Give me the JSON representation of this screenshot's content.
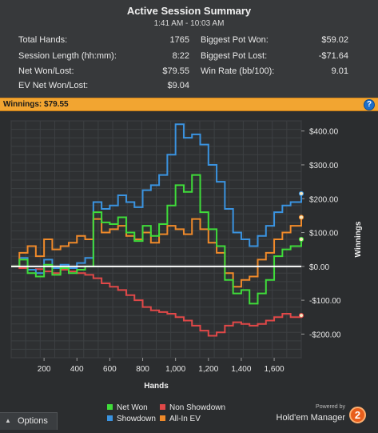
{
  "summary": {
    "title": "Active Session Summary",
    "time_range": "1:41 AM - 10:03 AM",
    "left_stats": [
      {
        "label": "Total Hands:",
        "value": "1765"
      },
      {
        "label": "Session Length (hh:mm):",
        "value": "8:22"
      },
      {
        "label": "Net Won/Lost:",
        "value": "$79.55"
      },
      {
        "label": "EV Net Won/Lost:",
        "value": "$9.04"
      }
    ],
    "right_stats": [
      {
        "label": "Biggest Pot Won:",
        "value": "$59.02"
      },
      {
        "label": "Biggest Pot Lost:",
        "value": "-$71.64"
      },
      {
        "label": "Win Rate (bb/100):",
        "value": "9.01"
      }
    ]
  },
  "winnings_bar": {
    "text": "Winnings: $79.55",
    "help_icon": "help-icon"
  },
  "legend": {
    "net_won": "Net Won",
    "non_showdown": "Non Showdown",
    "showdown": "Showdown",
    "all_in_ev": "All-In EV"
  },
  "branding": {
    "powered_by": "Powered by",
    "product": "Hold'em Manager",
    "logo_text": "2"
  },
  "options": {
    "label": "Options",
    "icon": "caret-up-icon"
  },
  "colors": {
    "net_won": "#3fdc3a",
    "non_showdown": "#e04848",
    "showdown": "#3a93e0",
    "all_in_ev": "#f08a2a",
    "zero_line": "#ffffff",
    "accent_bar": "#f2a531"
  },
  "chart_data": {
    "type": "line",
    "xlabel": "Hands",
    "ylabel": "Winnings",
    "xlim": [
      0,
      1765
    ],
    "ylim": [
      -270,
      430
    ],
    "x_ticks": [
      200,
      400,
      600,
      800,
      1000,
      1200,
      1400,
      1600
    ],
    "x_tick_labels": [
      "200",
      "400",
      "600",
      "800",
      "1,000",
      "1,200",
      "1,400",
      "1,600"
    ],
    "y_ticks": [
      400,
      300,
      200,
      100,
      0,
      -100,
      -200
    ],
    "y_tick_labels": [
      "$400.00",
      "$300.00",
      "$200.00",
      "$100.00",
      "$0.00",
      "-$100.00",
      "-$200.00"
    ],
    "grid": true,
    "legend_position": "bottom",
    "x": [
      0,
      50,
      100,
      150,
      200,
      250,
      300,
      350,
      400,
      450,
      500,
      550,
      600,
      650,
      700,
      750,
      800,
      850,
      900,
      950,
      1000,
      1050,
      1100,
      1150,
      1200,
      1250,
      1300,
      1350,
      1400,
      1450,
      1500,
      1550,
      1600,
      1650,
      1700,
      1765
    ],
    "series": [
      {
        "name": "Net Won",
        "values": [
          0,
          20,
          -20,
          -30,
          5,
          -25,
          -5,
          -20,
          -10,
          0,
          160,
          130,
          125,
          145,
          100,
          75,
          120,
          90,
          125,
          180,
          240,
          220,
          270,
          160,
          110,
          60,
          -40,
          -80,
          -70,
          -110,
          -80,
          -40,
          30,
          50,
          60,
          80
        ]
      },
      {
        "name": "Non Showdown",
        "values": [
          0,
          -5,
          -10,
          -8,
          -15,
          -20,
          -10,
          -15,
          -20,
          -25,
          -35,
          -50,
          -60,
          -70,
          -85,
          -100,
          -120,
          -130,
          -135,
          -140,
          -150,
          -160,
          -175,
          -190,
          -205,
          -195,
          -175,
          -165,
          -170,
          -175,
          -170,
          -160,
          -150,
          -140,
          -150,
          -145
        ]
      },
      {
        "name": "Showdown",
        "values": [
          0,
          25,
          -10,
          -20,
          20,
          -5,
          5,
          -5,
          10,
          25,
          190,
          170,
          180,
          210,
          190,
          175,
          225,
          240,
          270,
          330,
          420,
          380,
          390,
          360,
          300,
          250,
          170,
          100,
          80,
          60,
          90,
          120,
          160,
          180,
          190,
          215
        ]
      },
      {
        "name": "All-In EV",
        "values": [
          0,
          40,
          60,
          30,
          80,
          50,
          60,
          70,
          90,
          80,
          140,
          100,
          110,
          120,
          90,
          80,
          100,
          70,
          95,
          120,
          110,
          95,
          140,
          110,
          70,
          40,
          -20,
          -60,
          -40,
          -30,
          20,
          40,
          80,
          100,
          120,
          145
        ]
      }
    ]
  }
}
